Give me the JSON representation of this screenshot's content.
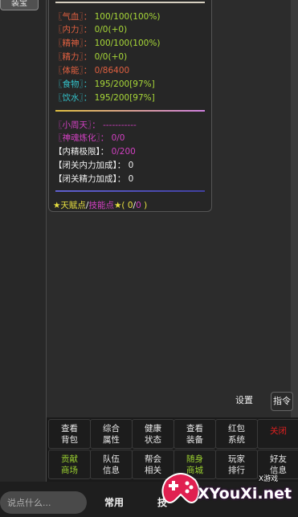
{
  "left_tab": "装宝",
  "stats": {
    "qixue": {
      "label": "〖气血〗",
      "sep": "：",
      "value": "100/100(100%)"
    },
    "neili": {
      "label": "〖内力〗",
      "sep": "：",
      "value": "0/0(+0)"
    },
    "jingshen": {
      "label": "〖精神〗",
      "sep": "：",
      "value": "100/100(100%)"
    },
    "jingli": {
      "label": "〖精力〗",
      "sep": "：",
      "value": "0/0(+0)"
    },
    "tineng": {
      "label": "〖体能〗",
      "sep": "：",
      "value": "0/86400"
    },
    "shiwu": {
      "label": "〖食物〗",
      "sep": "：",
      "value": "195/200[97%]"
    },
    "yinshui": {
      "label": "〖饮水〗",
      "sep": "：",
      "value": "195/200[97%]"
    },
    "xiaozhou": {
      "label": "〖小周天〗",
      "sep": "：",
      "value": "-----------"
    },
    "shenhun": {
      "label": "〖神魂炼化〗",
      "sep": "：",
      "value": "0/0"
    },
    "neijing": {
      "label": "【内精极限】",
      "sep": "：",
      "value": "0/200"
    },
    "biguan_neili": {
      "label": "【闭关内力加成】",
      "sep": "：",
      "value": "0"
    },
    "biguan_jingli": {
      "label": "【闭关精力加成】",
      "sep": "：",
      "value": "0"
    }
  },
  "talent": {
    "star1": "★",
    "tianfu": "天赋点",
    "slash": "/",
    "jineng": "技能点",
    "star2": "★",
    "open": "( ",
    "v1": "0",
    "vslash": "/",
    "v2": "0",
    "close": " )"
  },
  "buttons": {
    "settings": "设置",
    "command": "指令"
  },
  "grid": [
    [
      "查看\n背包",
      "综合\n属性",
      "健康\n状态",
      "查看\n装备",
      "红包\n系统",
      "关闭"
    ],
    [
      "贡献\n商场",
      "队伍\n信息",
      "帮会\n相关",
      "随身\n商城",
      "玩家\n排行",
      "好友\n信息"
    ]
  ],
  "chat": {
    "placeholder": "说点什么...",
    "common_label": "常用",
    "partial_label": "技"
  },
  "watermark": {
    "text": "XYouXi.net",
    "sub": "X游戏"
  }
}
